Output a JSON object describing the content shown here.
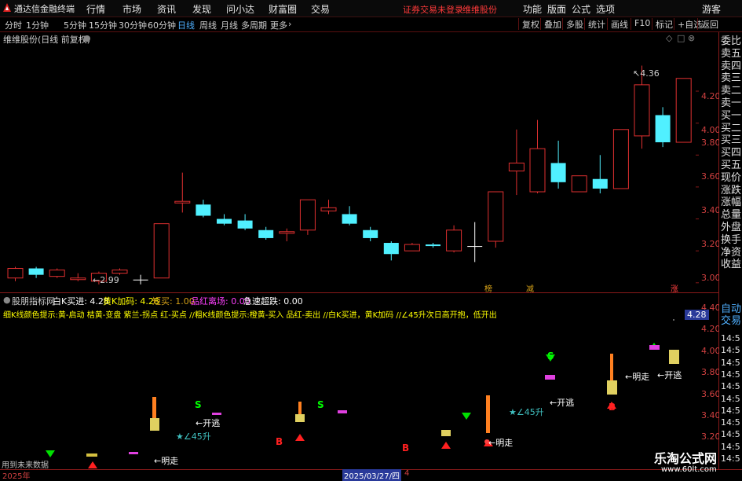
{
  "app": {
    "name": "通达信金融终端",
    "menu": [
      "行情",
      "市场",
      "资讯",
      "发现",
      "问小达",
      "财富圈",
      "交易"
    ],
    "warning": "证券交易未登录",
    "stock_name_top": "维维股份",
    "right_menu": [
      "功能",
      "版面",
      "公式",
      "选项"
    ],
    "guest": "游客"
  },
  "periods": [
    "分时",
    "1分钟",
    "5分钟",
    "15分钟",
    "30分钟",
    "60分钟",
    "日线",
    "周线",
    "月线",
    "多周期",
    "更多"
  ],
  "active_period": "日线",
  "more_icon": "chevron-right-icon",
  "toolbar": [
    "复权",
    "叠加",
    "多股",
    "统计",
    "画线",
    "F10",
    "标记",
    "+自选",
    "返回"
  ],
  "main_chart": {
    "title": "维维股份(日线 前复权)",
    "high_label": "4.36",
    "low_label": "2.99",
    "y_ticks": [
      "4.20",
      "4.00",
      "3.80",
      "3.60",
      "3.40",
      "3.20",
      "3.00"
    ],
    "tags": [
      {
        "text": "榜",
        "color": "#d4a017"
      },
      {
        "text": "减",
        "color": "#d4a017"
      },
      {
        "text": "涨",
        "color": "#ff4040"
      }
    ]
  },
  "indicator": {
    "name": "股朋指标网",
    "values": [
      {
        "label": "白K买进:",
        "value": "4.28",
        "color": "#ffffff"
      },
      {
        "label": "黄K加码:",
        "value": "4.28",
        "color": "#ffff00"
      },
      {
        "label": "短买:",
        "value": "1.00",
        "color": "#d4a017"
      },
      {
        "label": "品红离场:",
        "value": "0.00",
        "color": "#ff40ff"
      },
      {
        "label": "急速超跌:",
        "value": "0.00",
        "color": "#ffffff"
      }
    ],
    "hint": "细K线颜色提示:黄-启动 桔黄-变盘 紫兰-拐点 红-买点 //粗K线颜色提示:橙黄-买入 品红-卖出 //白K买进，黄K加码 //∠45升次日高开抱，低开出",
    "price_box": "4.28",
    "y_ticks": [
      "4.40",
      "4.20",
      "4.00",
      "3.80",
      "3.60",
      "3.40",
      "3.20"
    ],
    "annotations": [
      {
        "text": "←明走",
        "color": "#ffffff"
      },
      {
        "text": "←开逃",
        "color": "#ffffff"
      },
      {
        "text": "★∠45升",
        "color": "#40c0c0"
      },
      {
        "text": "S",
        "color": "#00ff00"
      },
      {
        "text": "S",
        "color": "#00ff00"
      },
      {
        "text": "S",
        "color": "#00ff00"
      },
      {
        "text": "B",
        "color": "#ff2020"
      },
      {
        "text": "B",
        "color": "#ff2020"
      },
      {
        "text": "B",
        "color": "#ff2020"
      },
      {
        "text": "←开逃",
        "color": "#ffffff"
      },
      {
        "text": "★∠45升",
        "color": "#40c0c0"
      },
      {
        "text": "←明走",
        "color": "#ffffff"
      },
      {
        "text": "←明走",
        "color": "#ffffff"
      },
      {
        "text": "←开逃",
        "color": "#ffffff"
      }
    ]
  },
  "side_panel": {
    "quote_items": [
      "委比",
      "卖五",
      "卖四",
      "卖三",
      "卖二",
      "卖一",
      "买一",
      "买二",
      "买三",
      "买四",
      "买五",
      "现价",
      "涨跌",
      "涨幅",
      "总量",
      "外盘",
      "换手",
      "净资",
      "收益"
    ],
    "lower_items": [
      "自动",
      "交易"
    ],
    "times": [
      "14:5",
      "14:5",
      "14:5",
      "14:5",
      "14:5",
      "14:5",
      "14:5",
      "14:5",
      "14:5",
      "14:5",
      "14:5"
    ]
  },
  "bottom": {
    "hint": "用到未来数据",
    "year": "2025年",
    "cursor_date": "2025/03/27/四",
    "cursor_extra": "4"
  },
  "watermark": {
    "title": "乐淘公式网",
    "url": "www.60lt.com"
  },
  "chart_data": {
    "type": "candlestick",
    "title": "维维股份(日线 前复权)",
    "ylim": [
      2.94,
      4.52
    ],
    "y_ticks": [
      3.0,
      3.2,
      3.4,
      3.6,
      3.8,
      4.0,
      4.2
    ],
    "candles": [
      {
        "o": 3.03,
        "c": 3.09,
        "h": 3.1,
        "l": 3.01
      },
      {
        "o": 3.09,
        "c": 3.05,
        "h": 3.1,
        "l": 3.03
      },
      {
        "o": 3.04,
        "c": 3.08,
        "h": 3.09,
        "l": 3.03
      },
      {
        "o": 3.02,
        "c": 3.03,
        "h": 3.06,
        "l": 3.01
      },
      {
        "o": 3.01,
        "c": 3.06,
        "h": 3.07,
        "l": 2.99
      },
      {
        "o": 3.06,
        "c": 3.08,
        "h": 3.09,
        "l": 3.05
      },
      {
        "o": 3.02,
        "c": 3.02,
        "h": 3.05,
        "l": 2.99
      },
      {
        "o": 3.03,
        "c": 3.37,
        "h": 3.37,
        "l": 3.03
      },
      {
        "o": 3.5,
        "c": 3.51,
        "h": 3.69,
        "l": 3.44
      },
      {
        "o": 3.49,
        "c": 3.42,
        "h": 3.52,
        "l": 3.41
      },
      {
        "o": 3.4,
        "c": 3.37,
        "h": 3.43,
        "l": 3.36
      },
      {
        "o": 3.39,
        "c": 3.34,
        "h": 3.43,
        "l": 3.33
      },
      {
        "o": 3.33,
        "c": 3.28,
        "h": 3.35,
        "l": 3.27
      },
      {
        "o": 3.31,
        "c": 3.32,
        "h": 3.34,
        "l": 3.26
      },
      {
        "o": 3.33,
        "c": 3.52,
        "h": 3.52,
        "l": 3.3
      },
      {
        "o": 3.45,
        "c": 3.47,
        "h": 3.52,
        "l": 3.43
      },
      {
        "o": 3.43,
        "c": 3.37,
        "h": 3.48,
        "l": 3.36
      },
      {
        "o": 3.33,
        "c": 3.28,
        "h": 3.35,
        "l": 3.26
      },
      {
        "o": 3.25,
        "c": 3.18,
        "h": 3.26,
        "l": 3.14
      },
      {
        "o": 3.2,
        "c": 3.24,
        "h": 3.25,
        "l": 3.2
      },
      {
        "o": 3.24,
        "c": 3.23,
        "h": 3.25,
        "l": 3.22
      },
      {
        "o": 3.2,
        "c": 3.33,
        "h": 3.36,
        "l": 3.19
      },
      {
        "o": 3.23,
        "c": 3.23,
        "h": 3.38,
        "l": 3.13
      },
      {
        "o": 3.26,
        "c": 3.57,
        "h": 3.57,
        "l": 3.22
      },
      {
        "o": 3.7,
        "c": 3.75,
        "h": 3.96,
        "l": 3.55
      },
      {
        "o": 3.57,
        "c": 3.84,
        "h": 4.02,
        "l": 3.56
      },
      {
        "o": 3.75,
        "c": 3.63,
        "h": 3.89,
        "l": 3.59
      },
      {
        "o": 3.57,
        "c": 3.67,
        "h": 3.67,
        "l": 3.57
      },
      {
        "o": 3.65,
        "c": 3.59,
        "h": 3.8,
        "l": 3.56
      },
      {
        "o": 3.59,
        "c": 3.96,
        "h": 3.96,
        "l": 3.59
      },
      {
        "o": 3.92,
        "c": 4.24,
        "h": 4.36,
        "l": 3.84
      },
      {
        "o": 4.05,
        "c": 3.88,
        "h": 4.1,
        "l": 3.85
      },
      {
        "o": 3.88,
        "c": 4.28,
        "h": 4.28,
        "l": 3.88
      }
    ]
  }
}
